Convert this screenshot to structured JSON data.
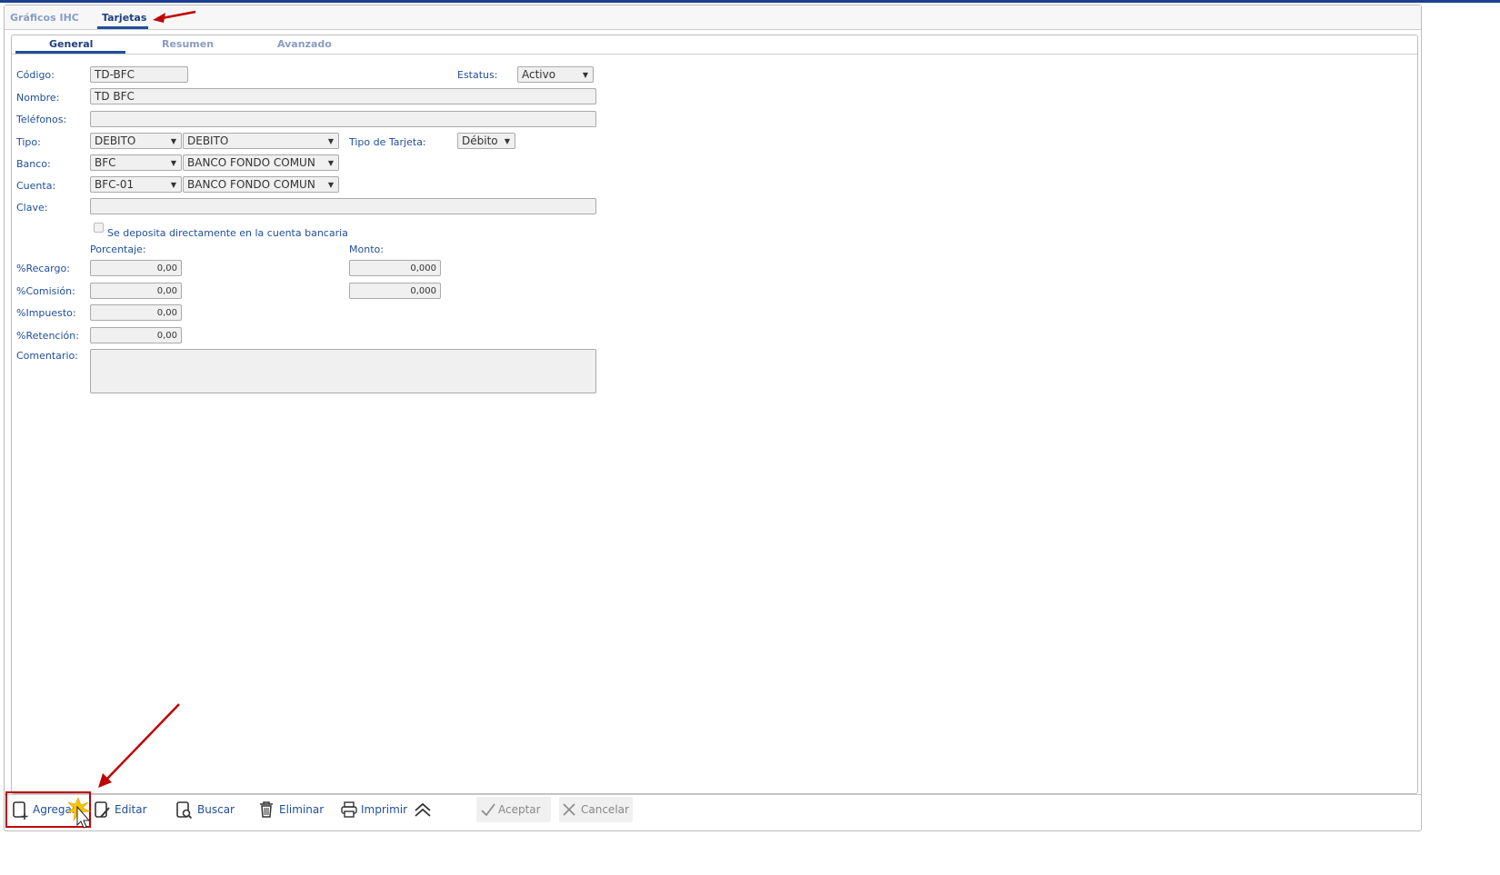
{
  "top_tabs": [
    "Gráficos IHC",
    "Tarjetas"
  ],
  "sub_tabs": [
    "General",
    "Resumen",
    "Avanzado"
  ],
  "form": {
    "codigo_label": "Código:",
    "codigo": "TD-BFC",
    "estatus_label": "Estatus:",
    "estatus": "Activo",
    "nombre_label": "Nombre:",
    "nombre": "TD BFC",
    "telefonos_label": "Teléfonos:",
    "telefonos": "",
    "tipo_label": "Tipo:",
    "tipo_code": "DEBITO",
    "tipo_desc": "DEBITO",
    "tipo_tarjeta_label": "Tipo de Tarjeta:",
    "tipo_tarjeta": "Débito",
    "banco_label": "Banco:",
    "banco_code": "BFC",
    "banco_desc": "BANCO FONDO COMUN",
    "cuenta_label": "Cuenta:",
    "cuenta_code": "BFC-01",
    "cuenta_desc": "BANCO FONDO COMUN",
    "clave_label": "Clave:",
    "clave": "",
    "deposita_label": "Se deposita directamente en la cuenta bancaria",
    "porcentaje_label": "Porcentaje:",
    "monto_label": "Monto:",
    "recargo_label": "%Recargo:",
    "recargo_pct": "0,00",
    "recargo_monto": "0,000",
    "comision_label": "%Comisión:",
    "comision_pct": "0,00",
    "comision_monto": "0,000",
    "impuesto_label": "%Impuesto:",
    "impuesto_pct": "0,00",
    "retencion_label": "%Retención:",
    "retencion_pct": "0,00",
    "comentario_label": "Comentario:",
    "comentario": ""
  },
  "toolbar": {
    "agregar": "Agregar",
    "editar": "Editar",
    "buscar": "Buscar",
    "eliminar": "Eliminar",
    "imprimir": "Imprimir",
    "aceptar": "Aceptar",
    "cancelar": "Cancelar"
  },
  "colors": {
    "accent": "#1f4e9c",
    "annotation": "#c00000"
  }
}
